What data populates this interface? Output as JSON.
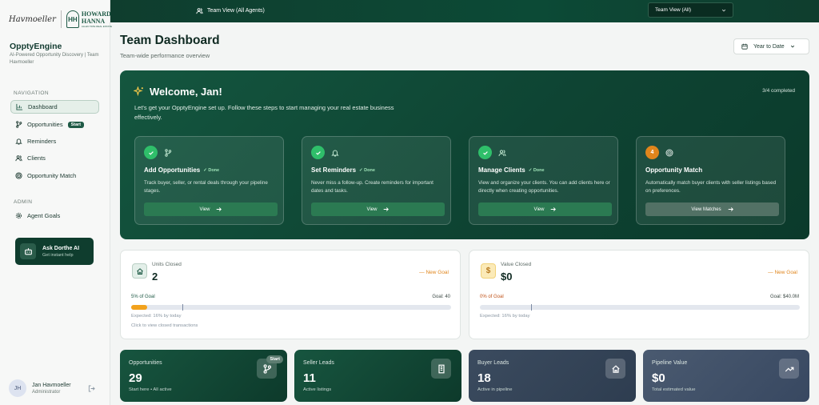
{
  "brand": {
    "logo_script": "Havmoeller",
    "logo_hh_mark": "HH",
    "logo_hh_text": "HOWARD HANNA",
    "logo_hh_sub": "ALLEN TATE REAL ESTATE"
  },
  "app": {
    "name": "OpptyEngine",
    "subtitle": "AI-Powered Opportunity Discovery | Team Havmoeller"
  },
  "nav": {
    "heading": "NAVIGATION",
    "items": [
      {
        "label": "Dashboard",
        "icon": "chart-icon",
        "active": true
      },
      {
        "label": "Opportunities",
        "icon": "branch-icon",
        "badge": "Start"
      },
      {
        "label": "Reminders",
        "icon": "bell-icon"
      },
      {
        "label": "Clients",
        "icon": "users-icon"
      },
      {
        "label": "Opportunity Match",
        "icon": "target-icon"
      }
    ],
    "admin_heading": "ADMIN",
    "admin_items": [
      {
        "label": "Agent Goals",
        "icon": "gear-icon"
      }
    ]
  },
  "ai_card": {
    "title": "Ask Dorthe AI",
    "subtitle": "Get instant help"
  },
  "user": {
    "initials": "JH",
    "name": "Jan Havmoeller",
    "role": "Administrator"
  },
  "topbar": {
    "view_label": "Team View (All Agents)",
    "select_value": "Team View (All)"
  },
  "page": {
    "title": "Team Dashboard",
    "subtitle": "Team-wide performance overview",
    "date_range": "Year to Date"
  },
  "welcome": {
    "title": "Welcome, Jan!",
    "progress": "3/4 completed",
    "description": "Let's get your OpptyEngine set up. Follow these steps to start managing your real estate business effectively.",
    "steps": [
      {
        "title": "Add Opportunities",
        "done": "✓ Done",
        "desc": "Track buyer, seller, or rental deals through your pipeline stages.",
        "button": "View",
        "status": "done"
      },
      {
        "title": "Set Reminders",
        "done": "✓ Done",
        "desc": "Never miss a follow-up. Create reminders for important dates and tasks.",
        "button": "View",
        "status": "done"
      },
      {
        "title": "Manage Clients",
        "done": "✓ Done",
        "desc": "View and organize your clients. You can add clients here or directly when creating opportunities.",
        "button": "View",
        "status": "done"
      },
      {
        "title": "Opportunity Match",
        "number": "4",
        "desc": "Automatically match buyer clients with seller listings based on preferences.",
        "button": "View Matches",
        "status": "pending"
      }
    ]
  },
  "stats": [
    {
      "label": "Units Closed",
      "value": "2",
      "goal_link": "New Goal",
      "pct_label": "5% of Goal",
      "target": "Goal: 40",
      "progress": 0.05,
      "expected": 0.16,
      "expected_label": "Expected: 16% by today",
      "click_hint": "Click to view closed transactions",
      "icon": "home-icon"
    },
    {
      "label": "Value Closed",
      "value": "$0",
      "goal_link": "New Goal",
      "pct_label": "0% of Goal",
      "target": "Goal: $40.0M",
      "progress": 0.0,
      "expected": 0.16,
      "expected_label": "Expected: 16% by today",
      "icon": "dollar-icon"
    }
  ],
  "tiles": [
    {
      "label": "Opportunities",
      "value": "29",
      "sub": "Start here • All active",
      "badge": "Start",
      "icon": "branch-icon"
    },
    {
      "label": "Seller Leads",
      "value": "11",
      "sub": "Active listings",
      "icon": "building-icon"
    },
    {
      "label": "Buyer Leads",
      "value": "18",
      "sub": "Active in pipeline",
      "icon": "home-icon"
    },
    {
      "label": "Pipeline Value",
      "value": "$0",
      "sub": "Total estimated value",
      "icon": "trending-icon"
    }
  ],
  "colors": {
    "brand_dark": "#0f3d2e",
    "accent_green": "#2fbf6a",
    "accent_orange": "#e0851c",
    "progress_orange": "#f2a21d"
  }
}
